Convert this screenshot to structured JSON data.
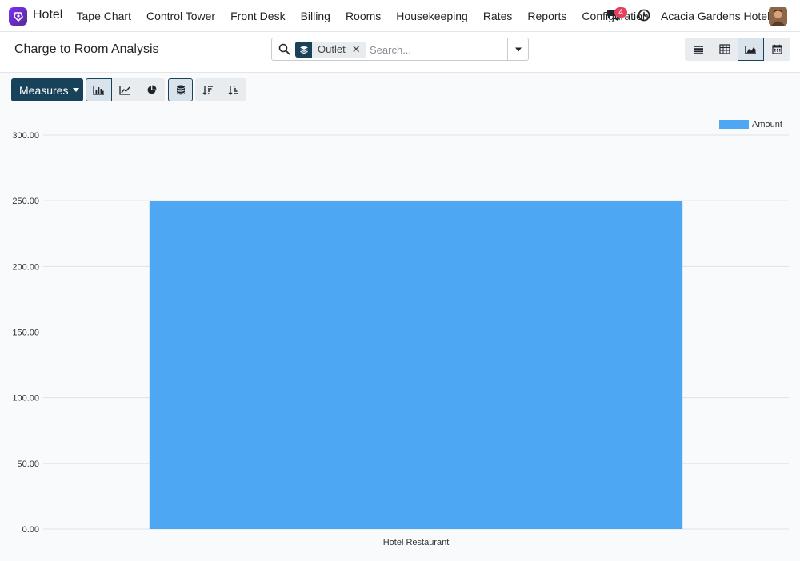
{
  "app": {
    "name": "Hotel",
    "company": "Acacia Gardens Hotel",
    "notification_count": "4"
  },
  "menu": [
    "Tape Chart",
    "Control Tower",
    "Front Desk",
    "Billing",
    "Rooms",
    "Housekeeping",
    "Rates",
    "Reports",
    "Configuration"
  ],
  "page": {
    "title": "Charge to Room Analysis"
  },
  "search": {
    "facet_label": "Outlet",
    "facet_remove": "✕",
    "placeholder": "Search..."
  },
  "toolbar": {
    "measures_label": "Measures"
  },
  "colors": {
    "primary": "#17425a",
    "bar": "#4ea7f2",
    "badge": "#e4405f"
  },
  "chart_data": {
    "type": "bar",
    "categories": [
      "Hotel Restaurant"
    ],
    "series": [
      {
        "name": "Amount",
        "values": [
          250
        ]
      }
    ],
    "yticks": [
      "0.00",
      "50.00",
      "100.00",
      "150.00",
      "200.00",
      "250.00",
      "300.00"
    ],
    "ylim": [
      0,
      300
    ],
    "grid": true,
    "legend": "top-right"
  }
}
